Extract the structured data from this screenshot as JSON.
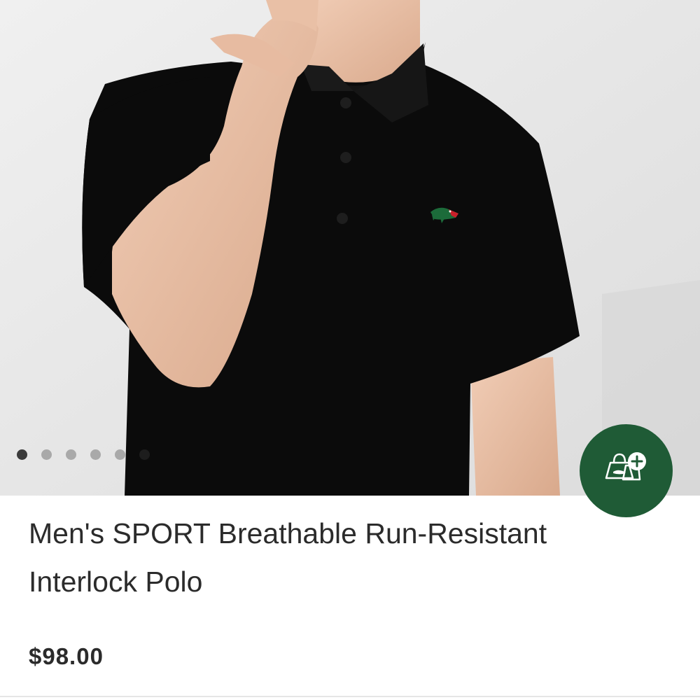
{
  "product": {
    "title": "Men's SPORT Breathable Run-Resistant Interlock Polo",
    "price": "$98.00",
    "image_description_icon": "product-photo-black-polo"
  },
  "carousel": {
    "total_slides": 6,
    "active_index": 0
  },
  "add_to_bag": {
    "icon": "shopping-bag-plus-icon",
    "color": "#1f5b36"
  },
  "colors": {
    "text": "#2b2b2b",
    "accent_green": "#1f5b36",
    "shirt": "#0b0b0b",
    "background": "#e8e8e8"
  }
}
